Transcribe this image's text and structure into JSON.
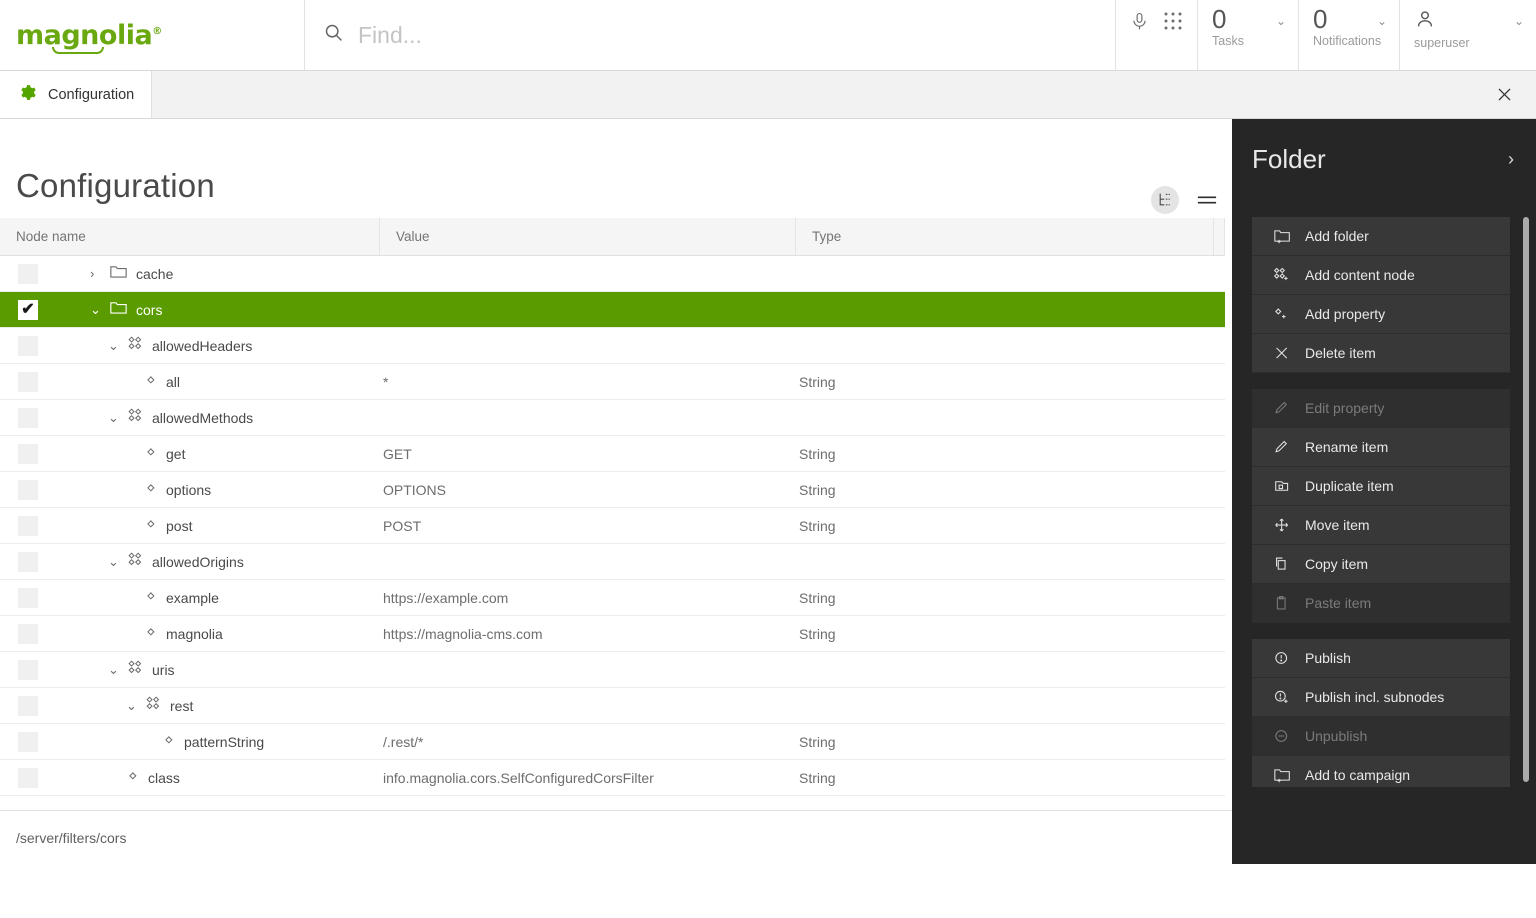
{
  "header": {
    "logo": "magnolia",
    "logo_sup": "®",
    "search_placeholder": "Find...",
    "mic_icon": "microphone-icon",
    "apps_icon": "apps-grid-icon",
    "tasks": {
      "count": "0",
      "label": "Tasks"
    },
    "notifications": {
      "count": "0",
      "label": "Notifications"
    },
    "user": {
      "name": "superuser"
    }
  },
  "tab": {
    "label": "Configuration",
    "icon": "gear-icon",
    "close_label": "×"
  },
  "page": {
    "title": "Configuration",
    "status_path": "/server/filters/cors"
  },
  "toolbar": {
    "tree_view_icon": "tree-view-icon",
    "list_view_icon": "list-view-icon"
  },
  "table": {
    "columns": [
      "Node name",
      "Value",
      "Type"
    ],
    "rows": [
      {
        "name": "cache",
        "value": "",
        "type": "",
        "indent": 0,
        "twisty": "›",
        "icon": "folder",
        "selected": false,
        "checked": false
      },
      {
        "name": "cors",
        "value": "",
        "type": "",
        "indent": 0,
        "twisty": "⌄",
        "icon": "folder",
        "selected": true,
        "checked": true
      },
      {
        "name": "allowedHeaders",
        "value": "",
        "type": "",
        "indent": 1,
        "twisty": "⌄",
        "icon": "node",
        "selected": false,
        "checked": false
      },
      {
        "name": "all",
        "value": "*",
        "type": "String",
        "indent": 2,
        "twisty": "",
        "icon": "prop",
        "selected": false,
        "checked": false
      },
      {
        "name": "allowedMethods",
        "value": "",
        "type": "",
        "indent": 1,
        "twisty": "⌄",
        "icon": "node",
        "selected": false,
        "checked": false
      },
      {
        "name": "get",
        "value": "GET",
        "type": "String",
        "indent": 2,
        "twisty": "",
        "icon": "prop",
        "selected": false,
        "checked": false
      },
      {
        "name": "options",
        "value": "OPTIONS",
        "type": "String",
        "indent": 2,
        "twisty": "",
        "icon": "prop",
        "selected": false,
        "checked": false
      },
      {
        "name": "post",
        "value": "POST",
        "type": "String",
        "indent": 2,
        "twisty": "",
        "icon": "prop",
        "selected": false,
        "checked": false
      },
      {
        "name": "allowedOrigins",
        "value": "",
        "type": "",
        "indent": 1,
        "twisty": "⌄",
        "icon": "node",
        "selected": false,
        "checked": false
      },
      {
        "name": "example",
        "value": "https://example.com",
        "type": "String",
        "indent": 2,
        "twisty": "",
        "icon": "prop",
        "selected": false,
        "checked": false
      },
      {
        "name": "magnolia",
        "value": "https://magnolia-cms.com",
        "type": "String",
        "indent": 2,
        "twisty": "",
        "icon": "prop",
        "selected": false,
        "checked": false
      },
      {
        "name": "uris",
        "value": "",
        "type": "",
        "indent": 1,
        "twisty": "⌄",
        "icon": "node",
        "selected": false,
        "checked": false
      },
      {
        "name": "rest",
        "value": "",
        "type": "",
        "indent": 2,
        "twisty": "⌄",
        "icon": "node",
        "selected": false,
        "checked": false
      },
      {
        "name": "patternString",
        "value": "/.rest/*",
        "type": "String",
        "indent": 3,
        "twisty": "",
        "icon": "prop",
        "selected": false,
        "checked": false
      },
      {
        "name": "class",
        "value": "info.magnolia.cors.SelfConfiguredCorsFilter",
        "type": "String",
        "indent": 1,
        "twisty": "",
        "icon": "prop",
        "selected": false,
        "checked": false
      }
    ]
  },
  "panel": {
    "title": "Folder",
    "expand_icon": "chevron-right-icon",
    "groups": [
      {
        "items": [
          {
            "label": "Add folder",
            "icon": "add-folder-icon",
            "disabled": false
          },
          {
            "label": "Add content node",
            "icon": "add-content-node-icon",
            "disabled": false
          },
          {
            "label": "Add property",
            "icon": "add-property-icon",
            "disabled": false
          },
          {
            "label": "Delete item",
            "icon": "delete-icon",
            "disabled": false
          }
        ]
      },
      {
        "items": [
          {
            "label": "Edit property",
            "icon": "pencil-icon",
            "disabled": true
          },
          {
            "label": "Rename item",
            "icon": "pencil-icon",
            "disabled": false
          },
          {
            "label": "Duplicate item",
            "icon": "duplicate-icon",
            "disabled": false
          },
          {
            "label": "Move item",
            "icon": "move-icon",
            "disabled": false
          },
          {
            "label": "Copy item",
            "icon": "copy-icon",
            "disabled": false
          },
          {
            "label": "Paste item",
            "icon": "paste-icon",
            "disabled": true
          }
        ]
      },
      {
        "items": [
          {
            "label": "Publish",
            "icon": "publish-icon",
            "disabled": false
          },
          {
            "label": "Publish incl. subnodes",
            "icon": "publish-subnodes-icon",
            "disabled": false
          },
          {
            "label": "Unpublish",
            "icon": "unpublish-icon",
            "disabled": true
          },
          {
            "label": "Add to campaign",
            "icon": "add-folder-icon",
            "disabled": false
          }
        ]
      }
    ]
  }
}
